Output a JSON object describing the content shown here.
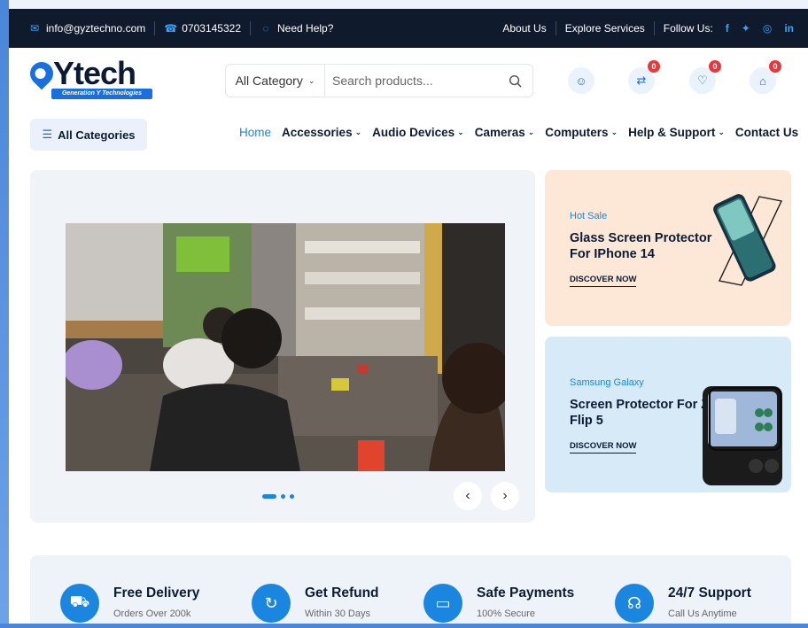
{
  "topbar": {
    "email": "info@gyztechno.com",
    "phone": "0703145322",
    "help": "Need Help?",
    "about": "About Us",
    "explore": "Explore Services",
    "follow": "Follow Us:",
    "social": [
      "f",
      "t",
      "ig",
      "in"
    ]
  },
  "logo": {
    "text": "Ytech",
    "tagline": "Generation Y Technologies"
  },
  "search": {
    "category": "All Category",
    "placeholder": "Search products..."
  },
  "header_icons": {
    "compare_count": "0",
    "wishlist_count": "0",
    "cart_count": "0"
  },
  "nav": {
    "all_categories": "All Categories",
    "items": [
      "Home",
      "Accessories",
      "Audio Devices",
      "Cameras",
      "Computers",
      "Help & Support",
      "Contact Us"
    ]
  },
  "promos": [
    {
      "subtitle": "Hot Sale",
      "title": "Glass Screen Protector For IPhone 14",
      "link": "DISCOVER NOW"
    },
    {
      "subtitle": "Samsung Galaxy",
      "title": "Screen Protector For Z Flip 5",
      "link": "DISCOVER NOW"
    }
  ],
  "features": [
    {
      "title": "Free Delivery",
      "subtitle": "Orders Over 200k"
    },
    {
      "title": "Get Refund",
      "subtitle": "Within 30 Days"
    },
    {
      "title": "Safe Payments",
      "subtitle": "100% Secure"
    },
    {
      "title": "24/7 Support",
      "subtitle": "Call Us Anytime"
    }
  ],
  "colors": {
    "accent": "#1a86e0",
    "topbar_bg": "#0f1a2c",
    "badge": "#e8383d"
  }
}
